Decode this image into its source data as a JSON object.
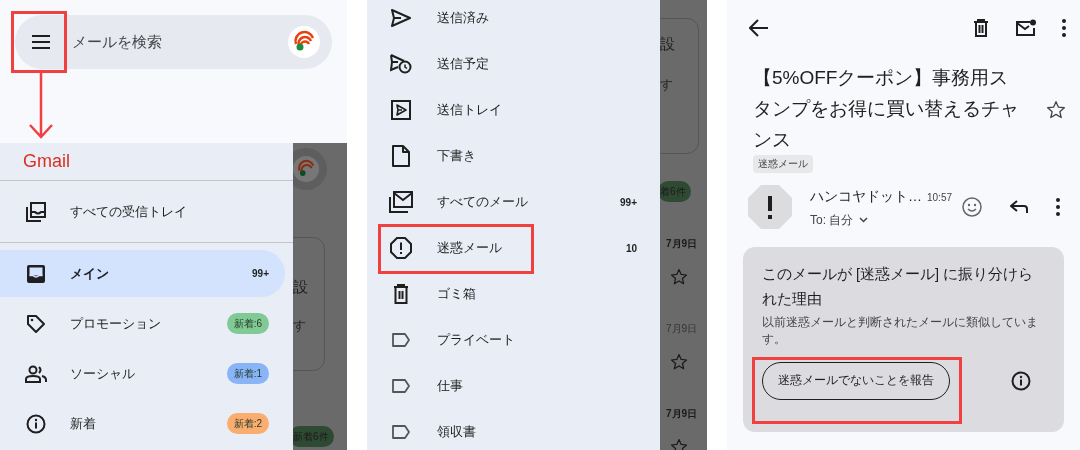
{
  "search_screen": {
    "search": {
      "placeholder": "メールを検索",
      "callout": true
    },
    "drawer": {
      "title": "Gmail",
      "items": [
        {
          "label": "すべての受信トレイ",
          "selected": false
        },
        {
          "label": "メイン",
          "count": "99+",
          "selected": true
        },
        {
          "label": "プロモーション",
          "badge": "新着:6",
          "color": "#81c995",
          "selected": false
        },
        {
          "label": "ソーシャル",
          "badge": "新着:1",
          "color": "#8ab4f8",
          "selected": false
        },
        {
          "label": "新着",
          "badge": "新着:2",
          "color": "#fbad70",
          "selected": false
        }
      ]
    },
    "dimmed_background": {
      "texts": [
        "設",
        "す",
        "新着6件"
      ]
    }
  },
  "folder_screen": {
    "items": [
      {
        "label": "送信済み",
        "callout": false
      },
      {
        "label": "送信予定",
        "callout": false
      },
      {
        "label": "送信トレイ",
        "callout": false
      },
      {
        "label": "下書き",
        "callout": false
      },
      {
        "label": "すべてのメール",
        "count": "99+",
        "callout": false
      },
      {
        "label": "迷惑メール",
        "count": "10",
        "callout": true
      },
      {
        "label": "ゴミ箱",
        "callout": false
      },
      {
        "label": "プライベート",
        "callout": false
      },
      {
        "label": "仕事",
        "callout": false
      },
      {
        "label": "領収書",
        "callout": false
      }
    ],
    "dimmed_background": {
      "texts": [
        "設",
        "す",
        "着6件"
      ],
      "dates": [
        {
          "text": "7月9日",
          "unread": true
        },
        {
          "text": "7月9日",
          "unread": false
        },
        {
          "text": "7月9日",
          "unread": true
        }
      ]
    }
  },
  "email_screen": {
    "subject": "【5%OFFクーポン】事務用スタンプをお得に買い替えるチャンス",
    "tag": "迷惑メール",
    "starred": false,
    "sender": "ハンコヤドット…",
    "time": "10:57",
    "to": "To: 自分",
    "spam_card": {
      "title": "このメールが [迷惑メール] に振り分けられた理由",
      "body": "以前迷惑メールと判断されたメールに類似しています。",
      "button": "迷惑メールでないことを報告",
      "callout": true
    }
  }
}
